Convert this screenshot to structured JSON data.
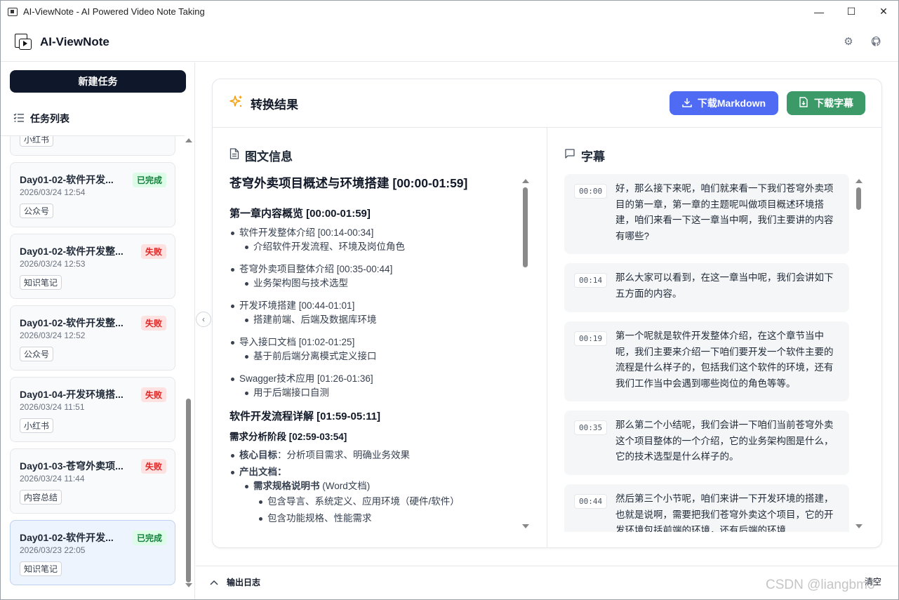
{
  "window": {
    "title": "AI-ViewNote - AI Powered Video Note Taking"
  },
  "header": {
    "brand": "AI-ViewNote"
  },
  "sidebar": {
    "new_task": "新建任务",
    "task_list_label": "任务列表",
    "partial_tag": "小红书",
    "tasks": [
      {
        "title": "Day01-02-软件开发...",
        "date": "2026/03/24 12:54",
        "tag": "公众号",
        "status": "已完成",
        "status_type": "success"
      },
      {
        "title": "Day01-02-软件开发整...",
        "date": "2026/03/24 12:53",
        "tag": "知识笔记",
        "status": "失败",
        "status_type": "error"
      },
      {
        "title": "Day01-02-软件开发整...",
        "date": "2026/03/24 12:52",
        "tag": "公众号",
        "status": "失败",
        "status_type": "error"
      },
      {
        "title": "Day01-04-开发环境搭...",
        "date": "2026/03/24 11:51",
        "tag": "小红书",
        "status": "失败",
        "status_type": "error"
      },
      {
        "title": "Day01-03-苍穹外卖项...",
        "date": "2026/03/24 11:44",
        "tag": "内容总结",
        "status": "失败",
        "status_type": "error"
      },
      {
        "title": "Day01-02-软件开发...",
        "date": "2026/03/23 22:05",
        "tag": "知识笔记",
        "status": "已完成",
        "status_type": "success",
        "selected": true
      }
    ]
  },
  "result": {
    "title": "转换结果",
    "download_md": "下载Markdown",
    "download_sub": "下载字幕",
    "doc_title": "图文信息",
    "sub_title": "字幕",
    "doc": {
      "h1": "苍穹外卖项目概述与环境搭建 [00:00-01:59]",
      "ch1": "第一章内容概览 [00:00-01:59]",
      "ch1_items": [
        {
          "main": "软件开发整体介绍 [00:14-00:34]",
          "sub": "介绍软件开发流程、环境及岗位角色"
        },
        {
          "main": "苍穹外卖项目整体介绍 [00:35-00:44]",
          "sub": "业务架构图与技术选型"
        },
        {
          "main": "开发环境搭建 [00:44-01:01]",
          "sub": "搭建前端、后端及数据库环境"
        },
        {
          "main": "导入接口文档 [01:02-01:25]",
          "sub": "基于前后端分离模式定义接口"
        },
        {
          "main": "Swagger技术应用 [01:26-01:36]",
          "sub": "用于后端接口自测"
        }
      ],
      "ch2": "软件开发流程详解 [01:59-05:11]",
      "ch2_sub": "需求分析阶段 [02:59-03:54]",
      "goal_label": "核心目标",
      "goal_text": "：分析项目需求、明确业务效果",
      "output_label": "产出文档",
      "output_colon": "：",
      "spec_label": "需求规格说明书",
      "spec_text": " (Word文档)",
      "spec_items": [
        "包含导言、系统定义、应用环境（硬件/软件）",
        "包含功能规格、性能需求"
      ]
    },
    "subtitles": [
      {
        "time": "00:00",
        "text": "好，那么接下来呢，咱们就来看一下我们苍穹外卖项目的第一章，第一章的主题呢叫做项目概述环境搭建，咱们来看一下这一章当中啊，我们主要讲的内容有哪些?"
      },
      {
        "time": "00:14",
        "text": "那么大家可以看到，在这一章当中呢，我们会讲如下五方面的内容。"
      },
      {
        "time": "00:19",
        "text": "第一个呢就是软件开发整体介绍，在这个章节当中呢，我们主要来介绍一下咱们要开发一个软件主要的流程是什么样子的，包括我们这个软件的环境，还有我们工作当中会遇到哪些岗位的角色等等。"
      },
      {
        "time": "00:35",
        "text": "那么第二个小结呢，我们会讲一下咱们当前苍穹外卖这个项目整体的一个介绍，它的业务架构图是什么，它的技术选型是什么样子的。"
      },
      {
        "time": "00:44",
        "text": "然后第三个小节呢，咱们来讲一下开发环境的搭建，也就是说啊，需要把我们苍穹外卖这个项目，它的开发环境包括前端的环境，还有后端的环境"
      }
    ]
  },
  "footer": {
    "log_label": "输出日志",
    "clear": "清空"
  },
  "watermark": "CSDN @liangbm3"
}
